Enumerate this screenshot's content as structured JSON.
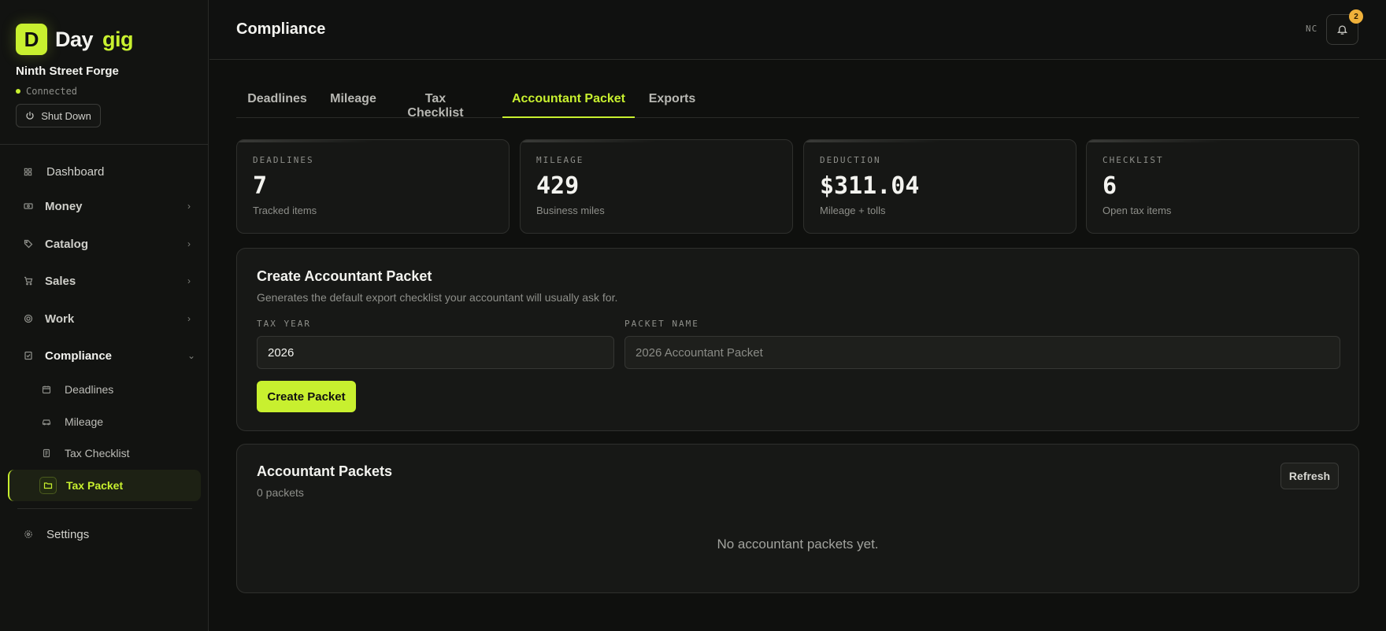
{
  "brand": {
    "logo_letter": "D",
    "name_part1": "Day",
    "name_part2": "gig",
    "accent_color": "#c8f02f"
  },
  "business": {
    "name": "Ninth Street Forge",
    "status": "Connected",
    "shutdown_label": "Shut Down"
  },
  "sidebar": {
    "items": [
      {
        "label": "Dashboard",
        "icon": "dashboard-icon"
      },
      {
        "label": "Money",
        "icon": "money-icon",
        "expandable": true
      },
      {
        "label": "Catalog",
        "icon": "tag-icon",
        "expandable": true
      },
      {
        "label": "Sales",
        "icon": "cart-icon",
        "expandable": true
      },
      {
        "label": "Work",
        "icon": "work-icon",
        "expandable": true
      },
      {
        "label": "Compliance",
        "icon": "clipboard-icon",
        "expanded": true
      }
    ],
    "sub_items": [
      {
        "label": "Deadlines",
        "icon": "calendar-icon"
      },
      {
        "label": "Mileage",
        "icon": "car-icon"
      },
      {
        "label": "Tax Checklist",
        "icon": "checklist-icon"
      },
      {
        "label": "Tax Packet",
        "icon": "folder-icon",
        "active": true
      }
    ],
    "settings_label": "Settings"
  },
  "header": {
    "title": "Compliance",
    "user_initials": "NC",
    "notification_count": "2"
  },
  "tabs": [
    {
      "label": "Deadlines"
    },
    {
      "label": "Mileage"
    },
    {
      "label": "Tax Checklist"
    },
    {
      "label": "Accountant Packet",
      "active": true
    },
    {
      "label": "Exports"
    }
  ],
  "stats": [
    {
      "label": "DEADLINES",
      "value": "7",
      "sub": "Tracked items"
    },
    {
      "label": "MILEAGE",
      "value": "429",
      "sub": "Business miles"
    },
    {
      "label": "DEDUCTION",
      "value": "$311.04",
      "sub": "Mileage + tolls"
    },
    {
      "label": "CHECKLIST",
      "value": "6",
      "sub": "Open tax items"
    }
  ],
  "create_panel": {
    "title": "Create Accountant Packet",
    "description": "Generates the default export checklist your accountant will usually ask for.",
    "tax_year_label": "TAX YEAR",
    "tax_year_value": "2026",
    "packet_name_label": "PACKET NAME",
    "packet_name_placeholder": "2026 Accountant Packet",
    "button_label": "Create Packet"
  },
  "packets_panel": {
    "title": "Accountant Packets",
    "count": "0 packets",
    "refresh_label": "Refresh",
    "empty_message": "No accountant packets yet."
  }
}
